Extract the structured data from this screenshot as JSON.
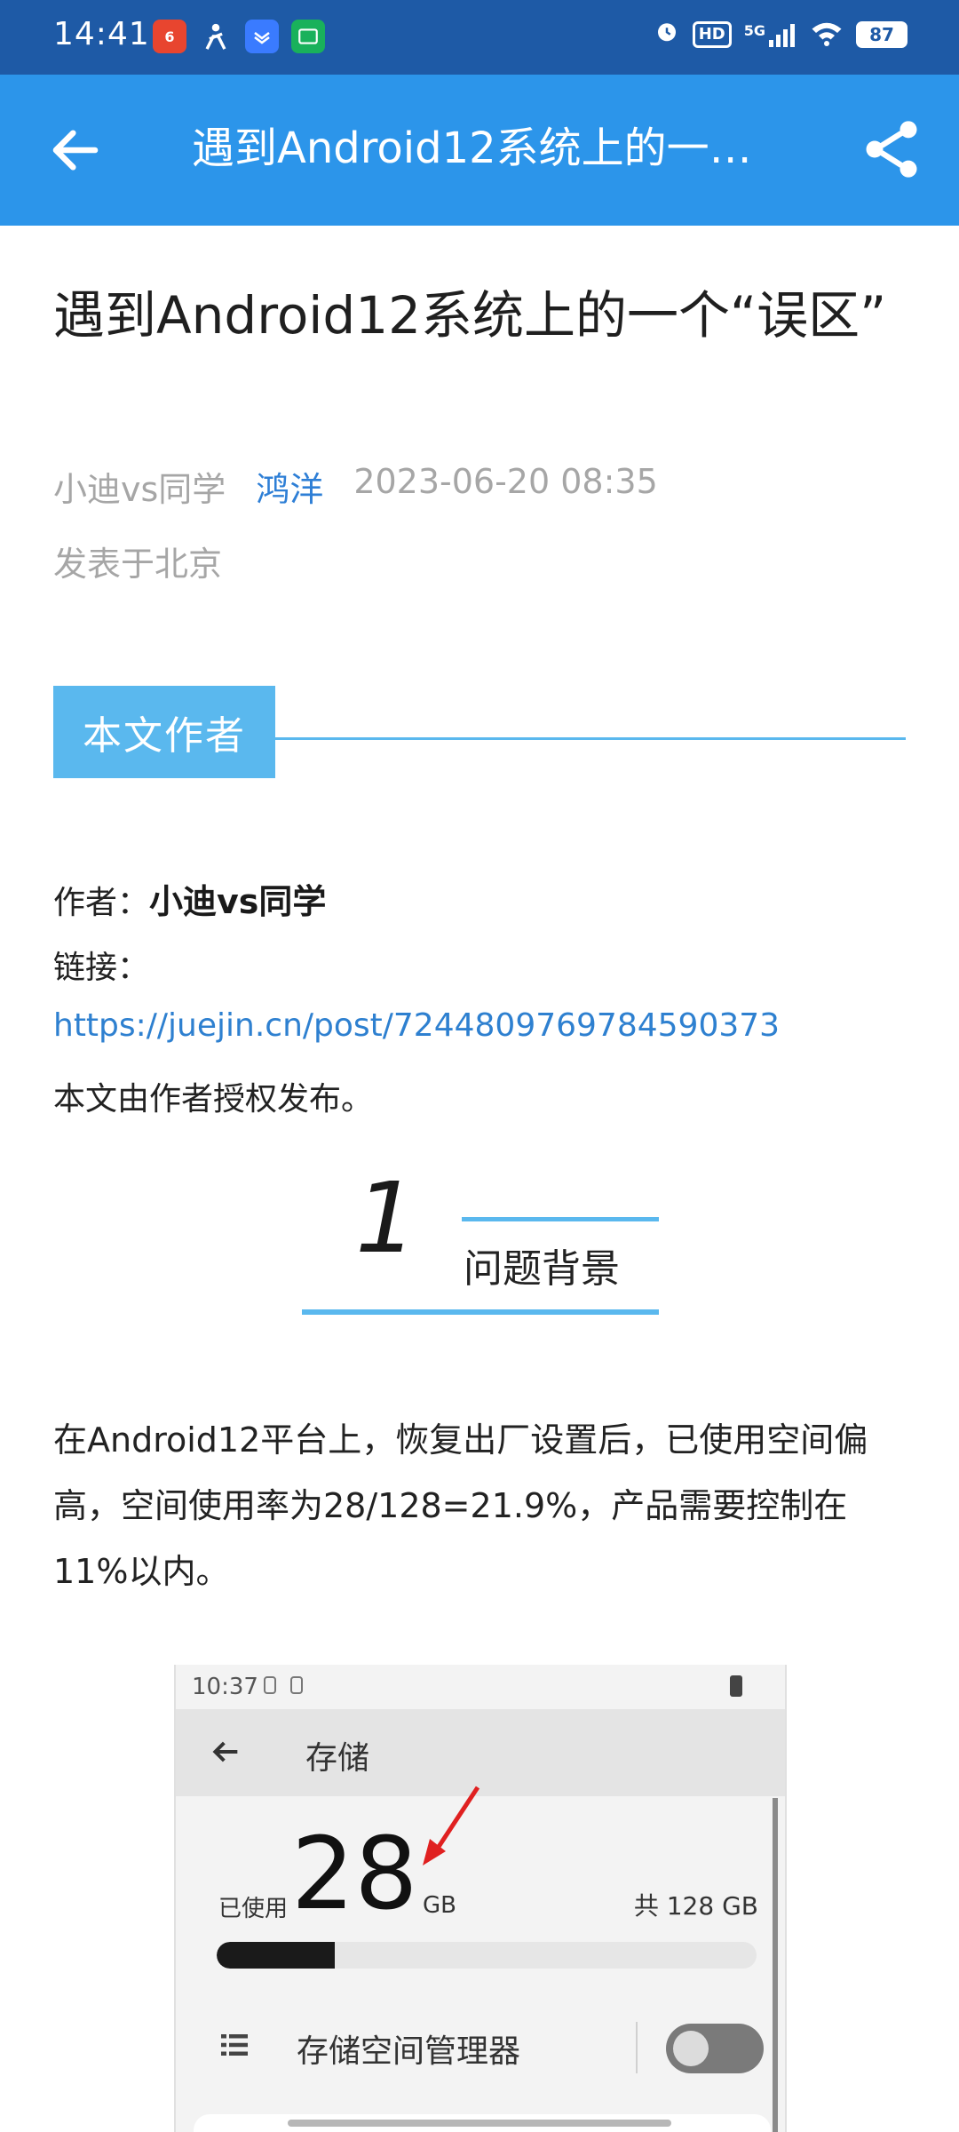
{
  "status_bar": {
    "time": "14:41",
    "network": "5G",
    "hd_label": "HD",
    "battery": "87",
    "app_icons": [
      "618-app-icon",
      "person-icon",
      "blue-app-icon",
      "green-app-icon"
    ]
  },
  "app_bar": {
    "title": "遇到Android12系统上的一个“误区”",
    "accent_color": "#2c95ea"
  },
  "article": {
    "title": "遇到Android12系统上的一个“误区”",
    "author_account": "小迪vs同学",
    "source": "鸿洋",
    "datetime": "2023-06-20 08:35",
    "location": "发表于北京"
  },
  "author_section": {
    "tag": "本文作者",
    "author_label": "作者：",
    "author_name": "小迪vs同学",
    "link_label": "链接：",
    "link_url": "https://juejin.cn/post/7244809769784590373",
    "license_note": "本文由作者授权发布。"
  },
  "section1": {
    "number": "1",
    "title": "问题背景",
    "body": "在Android12平台上，恢复出厂设置后，已使用空间偏高，空间使用率为28/128=21.9%，产品需要控制在11%以内。"
  },
  "embedded_screenshot": {
    "time": "10:37",
    "title": "存储",
    "used_label": "已使用",
    "used_value": "28",
    "used_unit": "GB",
    "total": "共 128 GB",
    "used_fraction": 0.219,
    "manager_label": "存储空间管理器",
    "toggle_on": false
  }
}
